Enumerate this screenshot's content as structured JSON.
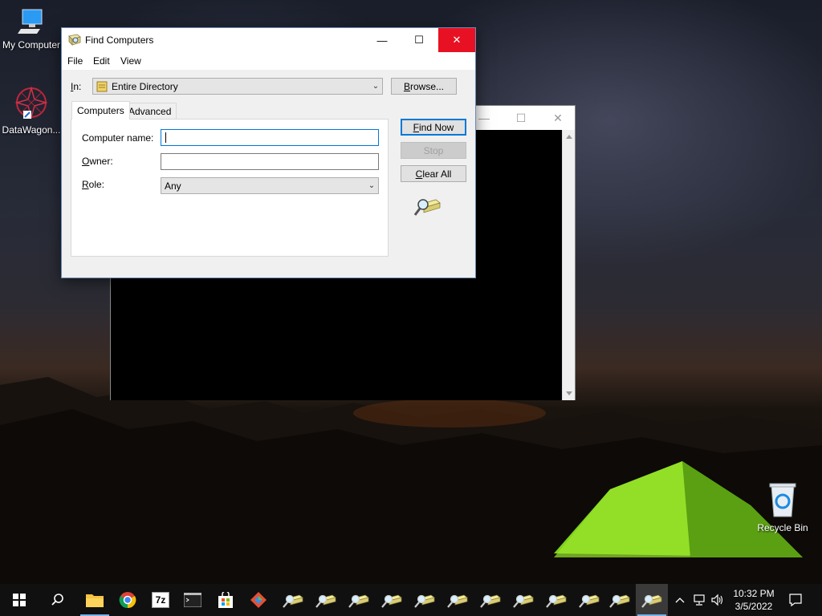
{
  "desktop": {
    "icons": [
      {
        "label": "My Computer",
        "icon": "computer-icon"
      },
      {
        "label": "DataWagon...",
        "icon": "datawagon-icon"
      },
      {
        "label": "Recycle Bin",
        "icon": "recycle-bin-icon"
      }
    ]
  },
  "console_window": {
    "minimize": "—",
    "maximize": "☐",
    "close": "✕"
  },
  "dialog": {
    "title": "Find Computers",
    "title_icon": "find-computers-icon",
    "controls": {
      "minimize": "—",
      "maximize": "☐",
      "close": "✕"
    },
    "menu": [
      "File",
      "Edit",
      "View"
    ],
    "in_label": "In:",
    "in_value": "Entire Directory",
    "browse_label": "Browse...",
    "tabs": [
      {
        "label": "Computers",
        "active": true
      },
      {
        "label": "Advanced",
        "active": false
      }
    ],
    "fields": {
      "computer_name_label": "Computer name:",
      "computer_name_value": "",
      "owner_label": "Owner:",
      "owner_value": "",
      "role_label": "Role:",
      "role_value": "Any"
    },
    "buttons": {
      "find_now": "Find Now",
      "stop": "Stop",
      "clear_all": "Clear All"
    }
  },
  "taskbar": {
    "items": [
      {
        "icon": "start-icon"
      },
      {
        "icon": "search-icon"
      },
      {
        "icon": "file-explorer-icon"
      },
      {
        "icon": "chrome-icon"
      },
      {
        "icon": "7zip-icon",
        "text": "7z"
      },
      {
        "icon": "terminal-icon"
      },
      {
        "icon": "store-icon"
      },
      {
        "icon": "git-icon"
      },
      {
        "icon": "find-computers-icon"
      },
      {
        "icon": "find-computers-icon"
      },
      {
        "icon": "find-computers-icon"
      },
      {
        "icon": "find-computers-icon"
      },
      {
        "icon": "find-computers-icon"
      },
      {
        "icon": "find-computers-icon"
      },
      {
        "icon": "find-computers-icon"
      },
      {
        "icon": "find-computers-icon"
      },
      {
        "icon": "find-computers-icon"
      },
      {
        "icon": "find-computers-icon"
      },
      {
        "icon": "find-computers-icon"
      },
      {
        "icon": "find-computers-icon",
        "active": true
      }
    ],
    "tray": {
      "chevron": "^",
      "time": "10:32 PM",
      "date": "3/5/2022"
    }
  },
  "colors": {
    "accent": "#0078d7",
    "close_red": "#e81123",
    "taskbar": "#101010"
  }
}
